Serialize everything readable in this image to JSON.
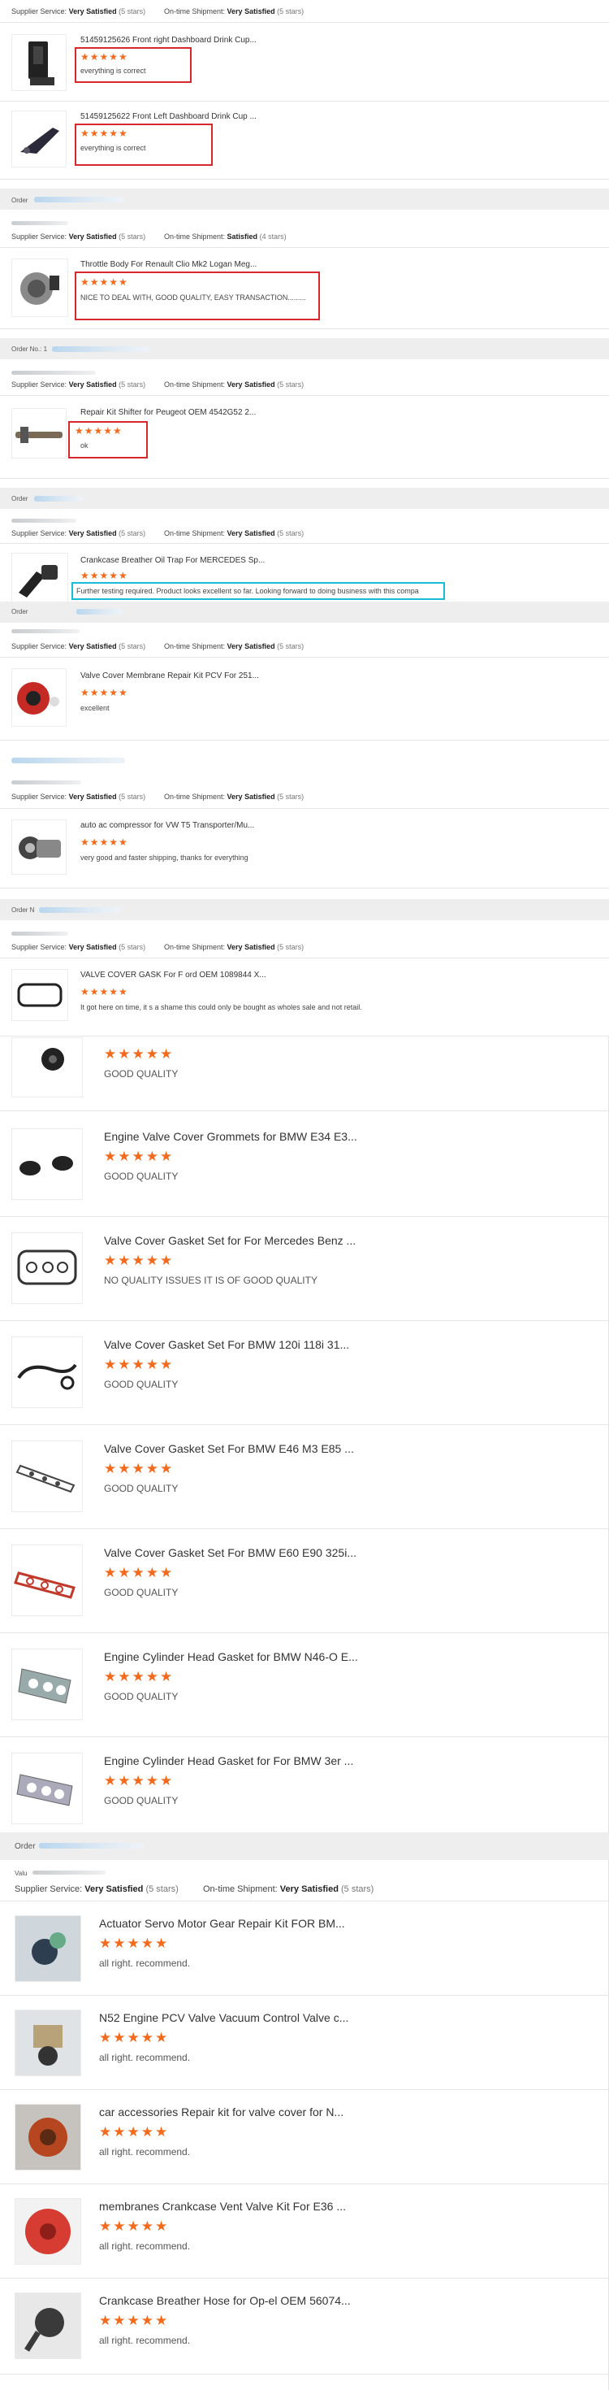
{
  "labels": {
    "supplier_service": "Supplier Service:",
    "on_time_shipment": "On-time Shipment:",
    "order": "Order",
    "order_no": "Order No.: 1",
    "order_n": "Order N",
    "very_satisfied": "Very Satisfied",
    "satisfied": "Satisfied",
    "five_stars": "(5 stars)",
    "four_stars": "(4 stars)"
  },
  "stars": "★★★★★",
  "section1": {
    "items": [
      {
        "title": "51459125626 Front right Dashboard Drink Cup...",
        "review": "everything is correct"
      },
      {
        "title": "51459125622 Front Left Dashboard Drink Cup ...",
        "review": "everything is correct"
      }
    ]
  },
  "orders_small": [
    {
      "title": "Throttle Body For Renault Clio Mk2 Logan Meg...",
      "review": "NICE TO DEAL WITH,  GOOD QUALITY,  EASY TRANSACTION.........",
      "shipment": "Satisfied",
      "shipment_stars": "(4 stars)"
    },
    {
      "title": "Repair Kit Shifter for Peugeot OEM 4542G52 2...",
      "review": "ok",
      "shipment": "Very Satisfied",
      "shipment_stars": "(5 stars)"
    },
    {
      "title": "Crankcase Breather Oil Trap For MERCEDES Sp...",
      "review": "Further testing required. Product looks excellent so far. Looking forward to doing business with this compa",
      "shipment": "Very Satisfied",
      "shipment_stars": "(5 stars)"
    },
    {
      "title": "Valve Cover Membrane Repair Kit PCV For 251...",
      "review": "excellent",
      "shipment": "Very Satisfied",
      "shipment_stars": "(5 stars)"
    },
    {
      "title": "auto ac compressor for VW T5 Transporter/Mu...",
      "review": "very good and faster shipping, thanks for everything",
      "shipment": "Very Satisfied",
      "shipment_stars": "(5 stars)"
    },
    {
      "title": "VALVE COVER GASK For F ord OEM 1089844 X...",
      "review": "It got here on time, it s a shame this could only be bought as wholes sale and not retail.",
      "shipment": "Very Satisfied",
      "shipment_stars": "(5 stars)"
    }
  ],
  "large_items": [
    {
      "title": "",
      "review": "GOOD QUALITY"
    },
    {
      "title": "Engine Valve Cover Grommets for BMW E34 E3...",
      "review": "GOOD QUALITY"
    },
    {
      "title": "Valve Cover Gasket Set for For Mercedes Benz ...",
      "review": "NO QUALITY ISSUES IT IS OF GOOD QUALITY"
    },
    {
      "title": "Valve Cover Gasket Set For BMW 120i 118i 31...",
      "review": "GOOD QUALITY"
    },
    {
      "title": "Valve Cover Gasket Set For BMW E46 M3 E85 ...",
      "review": "GOOD QUALITY"
    },
    {
      "title": "Valve Cover Gasket Set For BMW E60 E90 325i...",
      "review": "GOOD QUALITY"
    },
    {
      "title": "Engine Cylinder Head Gasket for BMW N46-O E...",
      "review": "GOOD QUALITY"
    },
    {
      "title": "Engine Cylinder Head Gasket for For BMW 3er ...",
      "review": "GOOD QUALITY"
    }
  ],
  "last_order": {
    "order_label": "Order",
    "val_label": "Valu",
    "items": [
      {
        "title": "Actuator Servo Motor Gear Repair Kit FOR BM...",
        "review": "all right. recommend."
      },
      {
        "title": "N52 Engine PCV Valve Vacuum Control Valve c...",
        "review": "all right. recommend."
      },
      {
        "title": "car accessories Repair kit for valve cover for N...",
        "review": "all right. recommend."
      },
      {
        "title": "membranes Crankcase Vent Valve Kit For E36 ...",
        "review": "all right. recommend."
      },
      {
        "title": "Crankcase Breather Hose for Op-el OEM 56074...",
        "review": "all right. recommend."
      }
    ]
  },
  "colors": {
    "star": "#f36a1c",
    "highlight_red": "#d9272e",
    "highlight_cyan": "#19bcd6",
    "band": "#eeeeee"
  }
}
